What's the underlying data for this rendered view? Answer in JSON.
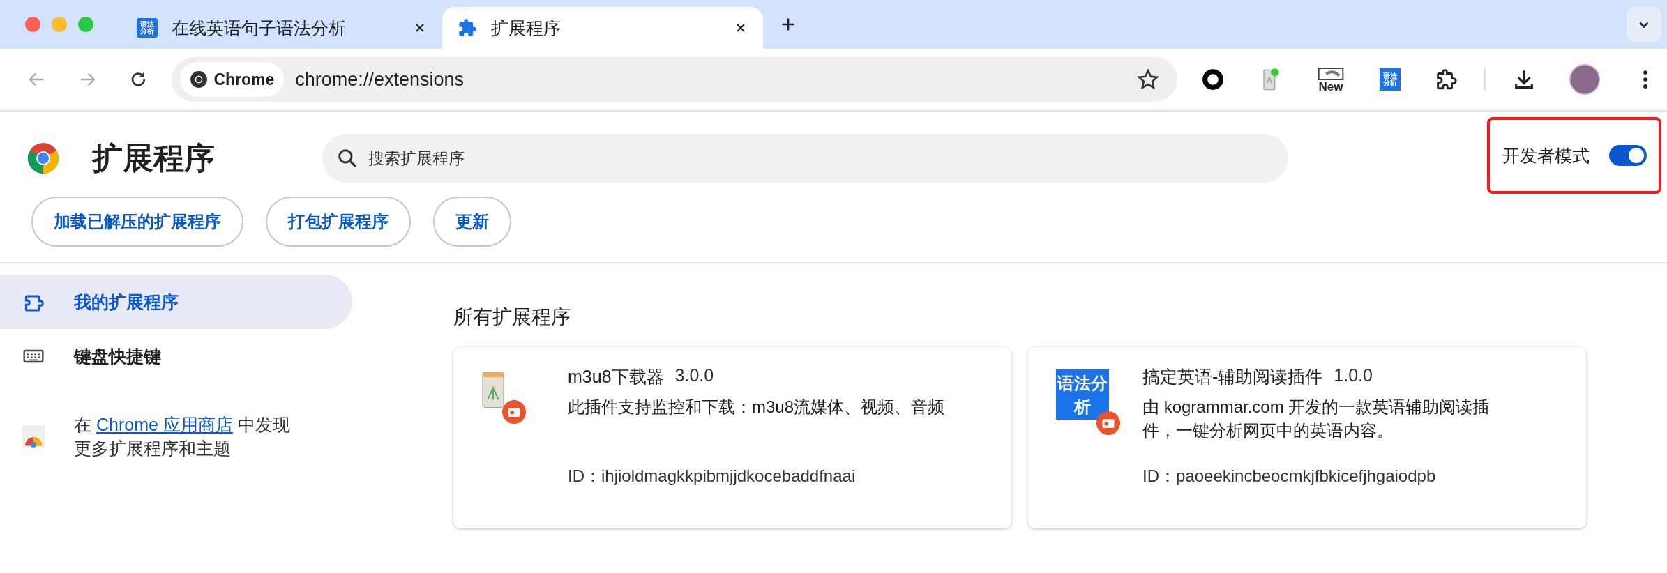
{
  "tabs": [
    {
      "title": "在线英语句子语法分析",
      "selected": false,
      "kind": "grammar",
      "icon_text": "语法分析"
    },
    {
      "title": "扩展程序",
      "selected": true,
      "kind": "puzzle"
    }
  ],
  "toolbar": {
    "site_chip": "Chrome",
    "url": "chrome://extensions",
    "extensions": [
      {
        "kind": "ring"
      },
      {
        "kind": "m3u8"
      },
      {
        "kind": "new",
        "label": "New"
      },
      {
        "kind": "grammar",
        "icon_text": "语法分析"
      },
      {
        "kind": "puzzle"
      }
    ]
  },
  "header": {
    "title": "扩展程序",
    "search": {
      "placeholder": "搜索扩展程序"
    },
    "developer_mode": {
      "label": "开发者模式",
      "on": true
    }
  },
  "actions": [
    "加载已解压的扩展程序",
    "打包扩展程序",
    "更新"
  ],
  "sidebar": {
    "items": [
      {
        "label": "我的扩展程序",
        "selected": true,
        "kind": "extensions"
      },
      {
        "label": "键盘快捷键",
        "selected": false,
        "kind": "keyboard"
      }
    ],
    "store_promo": {
      "prefix": "在",
      "link": "Chrome 应用商店",
      "suffix": "中发现更多扩展程序和主题"
    }
  },
  "section_title": "所有扩展程序",
  "extensions": [
    {
      "name": "m3u8下载器",
      "version": "3.0.0",
      "description": "此插件支持监控和下载：m3u8流媒体、视频、音频",
      "id_label": "ID：",
      "id": "ihjioldmagkkpibmjjdkocebaddfnaai",
      "kind": "m3u8"
    },
    {
      "name": "搞定英语-辅助阅读插件",
      "version": "1.0.0",
      "description": "由 kogrammar.com 开发的一款英语辅助阅读插件，一键分析网页中的英语内容。",
      "id_label": "ID：",
      "id": "paoeekincbeocmkjfbkicefjhgaiodpb",
      "kind": "grammar",
      "icon_text": "语法分析"
    }
  ]
}
